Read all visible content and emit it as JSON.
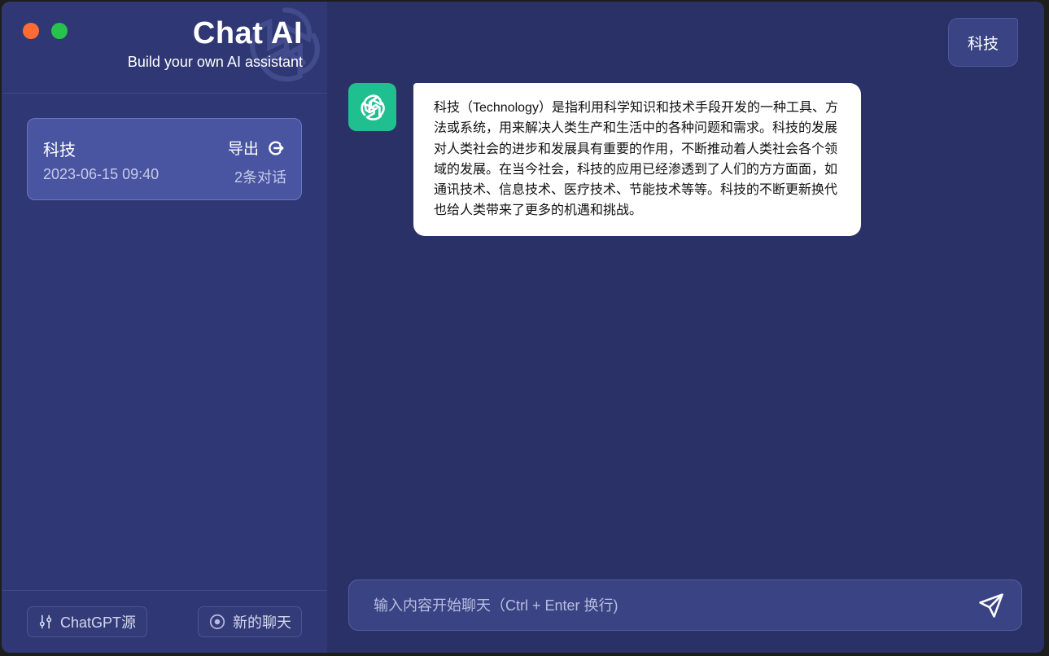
{
  "app": {
    "title": "Chat AI",
    "subtitle": "Build your own AI assistant"
  },
  "sidebar": {
    "conversations": [
      {
        "title": "科技",
        "export_label": "导出",
        "date": "2023-06-15 09:40",
        "count": "2条对话"
      }
    ],
    "source_button": "ChatGPT源",
    "new_chat_button": "新的聊天"
  },
  "chat": {
    "topic": "科技",
    "messages": [
      {
        "role": "assistant",
        "text": "科技（Technology）是指利用科学知识和技术手段开发的一种工具、方法或系统，用来解决人类生产和生活中的各种问题和需求。科技的发展对人类社会的进步和发展具有重要的作用，不断推动着人类社会各个领域的发展。在当今社会，科技的应用已经渗透到了人们的方方面面，如通讯技术、信息技术、医疗技术、节能技术等等。科技的不断更新换代也给人类带来了更多的机遇和挑战。"
      }
    ],
    "input_placeholder": "输入内容开始聊天（Ctrl + Enter 换行)"
  },
  "icons": {
    "close": "close-dot",
    "maximize": "maximize-dot",
    "export": "export-icon",
    "source": "sliders-icon",
    "new_chat": "plus-circle-icon",
    "avatar": "openai-icon",
    "send": "send-icon"
  },
  "colors": {
    "sidebar_bg": "#2f3874",
    "main_bg": "#2a3166",
    "card_bg": "#4a55a2",
    "avatar_bg": "#1fbf8f",
    "close_dot": "#ff6b35",
    "max_dot": "#27c24c"
  }
}
